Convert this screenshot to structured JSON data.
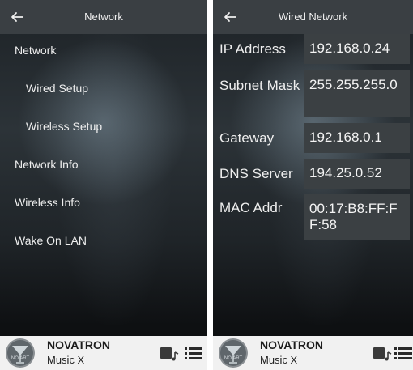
{
  "left_screen": {
    "header": {
      "title": "Network"
    },
    "menu": [
      {
        "label": "Network"
      },
      {
        "label": "Wired Setup"
      },
      {
        "label": "Wireless Setup"
      },
      {
        "label": "Network Info"
      },
      {
        "label": "Wireless Info"
      },
      {
        "label": "Wake On LAN"
      }
    ],
    "footer": {
      "title": "NOVATRON",
      "subtitle": "Music X",
      "logo_text": "NO ART"
    }
  },
  "right_screen": {
    "header": {
      "title": "Wired Network"
    },
    "rows": [
      {
        "label": "IP Address",
        "value": "192.168.0.24"
      },
      {
        "label": "Subnet Mask",
        "value": "255.255.255.0"
      },
      {
        "label": "Gateway",
        "value": "192.168.0.1"
      },
      {
        "label": "DNS Server",
        "value": "194.25.0.52"
      },
      {
        "label": "MAC Addr",
        "value": "00:17:B8:FF:FF:58"
      }
    ],
    "footer": {
      "title": "NOVATRON",
      "subtitle": "Music X",
      "logo_text": "NO ART"
    }
  },
  "icons": {
    "back": "arrow-left-icon",
    "queue": "music-stack-icon",
    "menu": "list-icon"
  },
  "colors": {
    "header_bg": "#3a3f43",
    "footer_bg": "#f1f1f1",
    "value_box_bg": "#3b4043",
    "text_light": "#eeeeee",
    "text_dark": "#1c1c1c"
  }
}
